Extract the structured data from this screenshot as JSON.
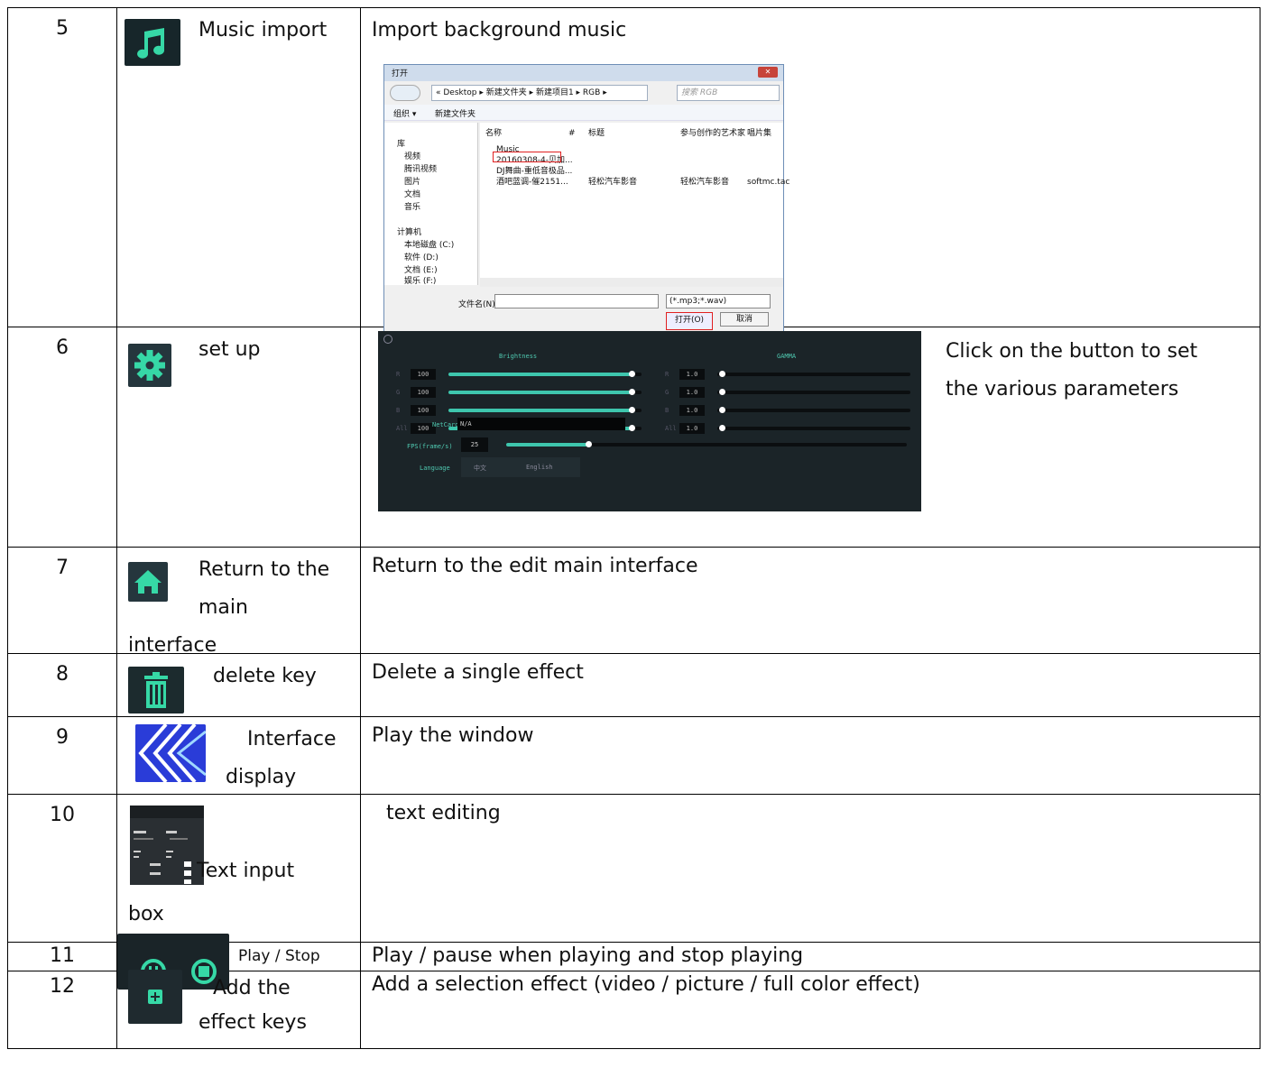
{
  "rows": [
    {
      "num": "5",
      "name": "Music import",
      "desc": "Import background music",
      "icon": "music-note-icon"
    },
    {
      "num": "6",
      "name": "set up",
      "desc_lines": [
        "Click on the button to set",
        "the various parameters"
      ],
      "icon": "gear-icon"
    },
    {
      "num": "7",
      "name_lines": [
        "Return to the",
        "main",
        "interface"
      ],
      "desc": "Return to the edit main interface",
      "icon": "home-icon"
    },
    {
      "num": "8",
      "name": "delete key",
      "desc": "Delete a single effect",
      "icon": "trash-icon"
    },
    {
      "num": "9",
      "name_lines": [
        "Interface",
        "display"
      ],
      "desc": "Play the window",
      "icon": "chevron-left-icon"
    },
    {
      "num": "10",
      "name_lines": [
        "Text input",
        "box"
      ],
      "desc": "text editing",
      "icon": "text-input-box-icon"
    },
    {
      "num": "11",
      "name": "Play / Stop",
      "desc": "Play / pause when playing and stop playing",
      "icon": "play-stop-icon"
    },
    {
      "num": "12",
      "name_lines": [
        "Add the",
        "effect keys"
      ],
      "desc": "Add a selection effect (video / picture / full color effect)",
      "icon": "add-icon"
    }
  ],
  "open_dialog": {
    "title": "打开",
    "path": "« Desktop ▸ 新建文件夹 ▸ 新建项目1 ▸ RGB ▸",
    "search_placeholder": "搜索 RGB",
    "toolbar_organize": "组织 ▾",
    "toolbar_new_folder": "新建文件夹",
    "nav_items": [
      "库",
      "视频",
      "腾讯视频",
      "图片",
      "文档",
      "音乐",
      "计算机",
      "本地磁盘 (C:)",
      "软件 (D:)",
      "文档 (E:)",
      "娱乐 (F:)"
    ],
    "col_name": "名称",
    "col_num": "#",
    "col_title": "标题",
    "col_artist": "参与创作的艺术家",
    "col_album": "唱片集",
    "files": [
      "Music",
      "20160308-4-贝加...",
      "DJ舞曲-重低音极品...",
      "酒吧蓝调-催2151..."
    ],
    "file4_title": "轻松汽车影音",
    "file4_artist": "轻松汽车影音",
    "file4_album": "softmc.tac",
    "filename_label": "文件名(N):",
    "filter": "(*.mp3;*.wav)",
    "open_button": "打开(O)",
    "cancel_button": "取消"
  },
  "settings_panel": {
    "brightness_title": "Brightness",
    "gamma_title": "GAMMA",
    "brightness_rows": [
      {
        "label": "R",
        "value": "100"
      },
      {
        "label": "G",
        "value": "100"
      },
      {
        "label": "B",
        "value": "100"
      },
      {
        "label": "All",
        "value": "100"
      }
    ],
    "gamma_rows": [
      {
        "label": "R",
        "value": "1.0"
      },
      {
        "label": "G",
        "value": "1.0"
      },
      {
        "label": "B",
        "value": "1.0"
      },
      {
        "label": "All",
        "value": "1.0"
      }
    ],
    "netcard_label": "NetCard",
    "netcard_value": "N/A",
    "fps_label": "FPS(frame/s)",
    "fps_value": "25",
    "language_label": "Language",
    "language_zh": "中文",
    "language_en": "English",
    "accent_color": "#3ec6ad"
  }
}
